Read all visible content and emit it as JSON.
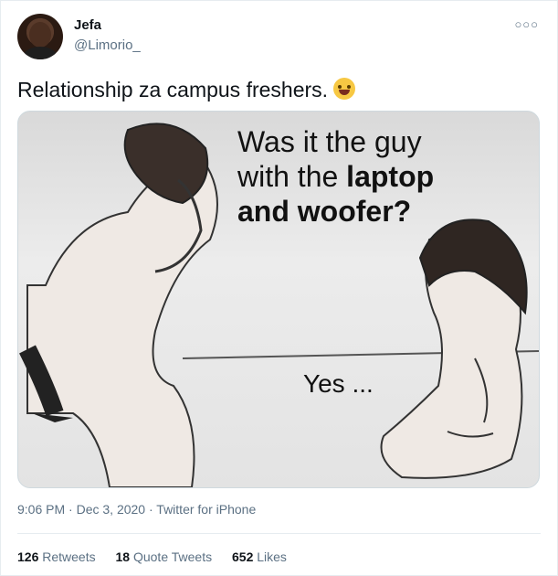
{
  "user": {
    "name": "Jefa",
    "handle": "@Limorio_"
  },
  "tweet": {
    "text": "Relationship za campus freshers.",
    "emoji_icon": "face-with-tears-of-joy-icon"
  },
  "media": {
    "caption_line1": "Was it the guy",
    "caption_line2_a": "with the ",
    "caption_line2_b": "laptop",
    "caption_line3": "and woofer?",
    "answer": "Yes ..."
  },
  "meta": {
    "time": "9:06 PM",
    "date": "Dec 3, 2020",
    "source": "Twitter for iPhone",
    "separator": "·"
  },
  "stats": {
    "retweets_count": "126",
    "retweets_label": "Retweets",
    "quotes_count": "18",
    "quotes_label": "Quote Tweets",
    "likes_count": "652",
    "likes_label": "Likes"
  },
  "colors": {
    "secondary_text": "#5b7083",
    "border": "#e6ecf0"
  }
}
